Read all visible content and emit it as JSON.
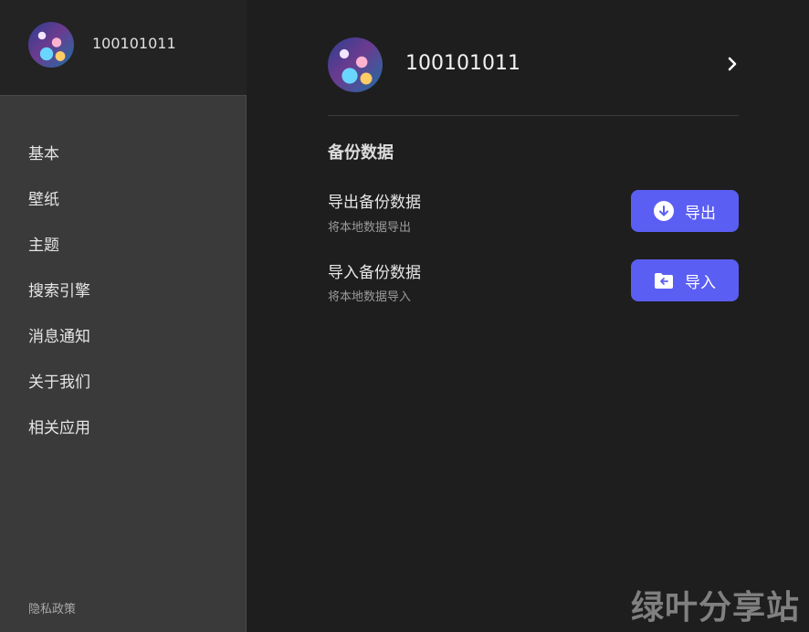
{
  "sidebar": {
    "username": "100101011",
    "items": [
      {
        "label": "基本"
      },
      {
        "label": "壁纸"
      },
      {
        "label": "主题"
      },
      {
        "label": "搜索引擎"
      },
      {
        "label": "消息通知"
      },
      {
        "label": "关于我们"
      },
      {
        "label": "相关应用"
      }
    ],
    "privacy_label": "隐私政策"
  },
  "main": {
    "profile": {
      "username": "100101011",
      "chevron_icon": "chevron-right-icon"
    },
    "section_title": "备份数据",
    "options": [
      {
        "title": "导出备份数据",
        "description": "将本地数据导出",
        "button_label": "导出",
        "icon": "download-circle-icon"
      },
      {
        "title": "导入备份数据",
        "description": "将本地数据导入",
        "button_label": "导入",
        "icon": "folder-import-icon"
      }
    ]
  },
  "watermark": "绿叶分享站",
  "colors": {
    "accent": "#5b5ef2",
    "background": "#1e1e1e",
    "sidebar": "#3a3a3a"
  }
}
